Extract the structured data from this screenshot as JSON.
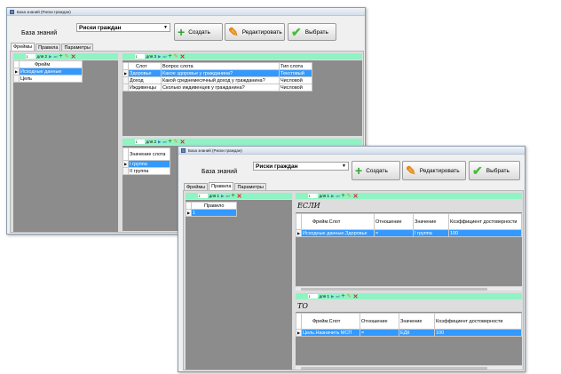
{
  "back": {
    "title": "База знаний (Риски граждан)",
    "kb_label": "База знаний",
    "kb_value": "Риски граждан",
    "buttons": {
      "create": "Создать",
      "edit": "Редактировать",
      "select": "Выбрать"
    },
    "tabs": [
      "Фреймы",
      "Правила",
      "Параметры"
    ],
    "frames": {
      "nav_page": "1",
      "nav_of": "для 2",
      "header": "Фрейм",
      "rows": [
        "Исходные данные",
        "Цель"
      ]
    },
    "slots": {
      "nav_page": "1",
      "nav_of": "для 3",
      "headers": [
        "Слот",
        "Вопрос слота",
        "Тип слота"
      ],
      "rows": [
        [
          "Здоровье",
          "Какое здоровье у гражданина?",
          "Текстовый"
        ],
        [
          "Доход",
          "Какой среднемесячный доход у гражданина?",
          "Числовой"
        ],
        [
          "Иждивенцы",
          "Сколько иждивенцев у гражданина?",
          "Числовой"
        ]
      ]
    },
    "values": {
      "nav_page": "1",
      "nav_of": "для 2",
      "header": "Значение слота",
      "rows": [
        "I группа",
        "II группа"
      ]
    }
  },
  "front": {
    "title": "База знаний (Риски граждан)",
    "kb_label": "База знаний",
    "kb_value": "Риски граждан",
    "buttons": {
      "create": "Создать",
      "edit": "Редактировать",
      "select": "Выбрать"
    },
    "tabs": [
      "Фреймы",
      "Правила",
      "Параметры"
    ],
    "rules": {
      "nav_page": "1",
      "nav_of": "для 1",
      "header": "Правило",
      "rows": [
        "1"
      ]
    },
    "if_label": "ЕСЛИ",
    "then_label": "ТО",
    "cond": {
      "nav_page": "1",
      "nav_of": "для 1",
      "headers": [
        "Фрейм.Слот",
        "Отношение",
        "Значение",
        "Коэффициент достоверности"
      ],
      "rows": [
        [
          "Исходные данные.Здоровье",
          "=",
          "I группа",
          "100"
        ]
      ]
    },
    "concl": {
      "nav_page": "1",
      "nav_of": "для 1",
      "headers": [
        "Фрейм.Слот",
        "Отношение",
        "Значение",
        "Коэффициент достоверности"
      ],
      "rows": [
        [
          "Цель.Назначить МСП",
          "=",
          "ЕДК",
          "100"
        ]
      ]
    }
  },
  "icons": {
    "first": "first-icon",
    "prev": "prev-icon",
    "next": "next-icon",
    "last": "last-icon",
    "add": "add-icon",
    "edit": "edit-icon",
    "delete": "delete-icon"
  },
  "colors": {
    "nav": "#8ff3c4",
    "selection": "#3399ff",
    "empty": "#8c8c8c"
  }
}
